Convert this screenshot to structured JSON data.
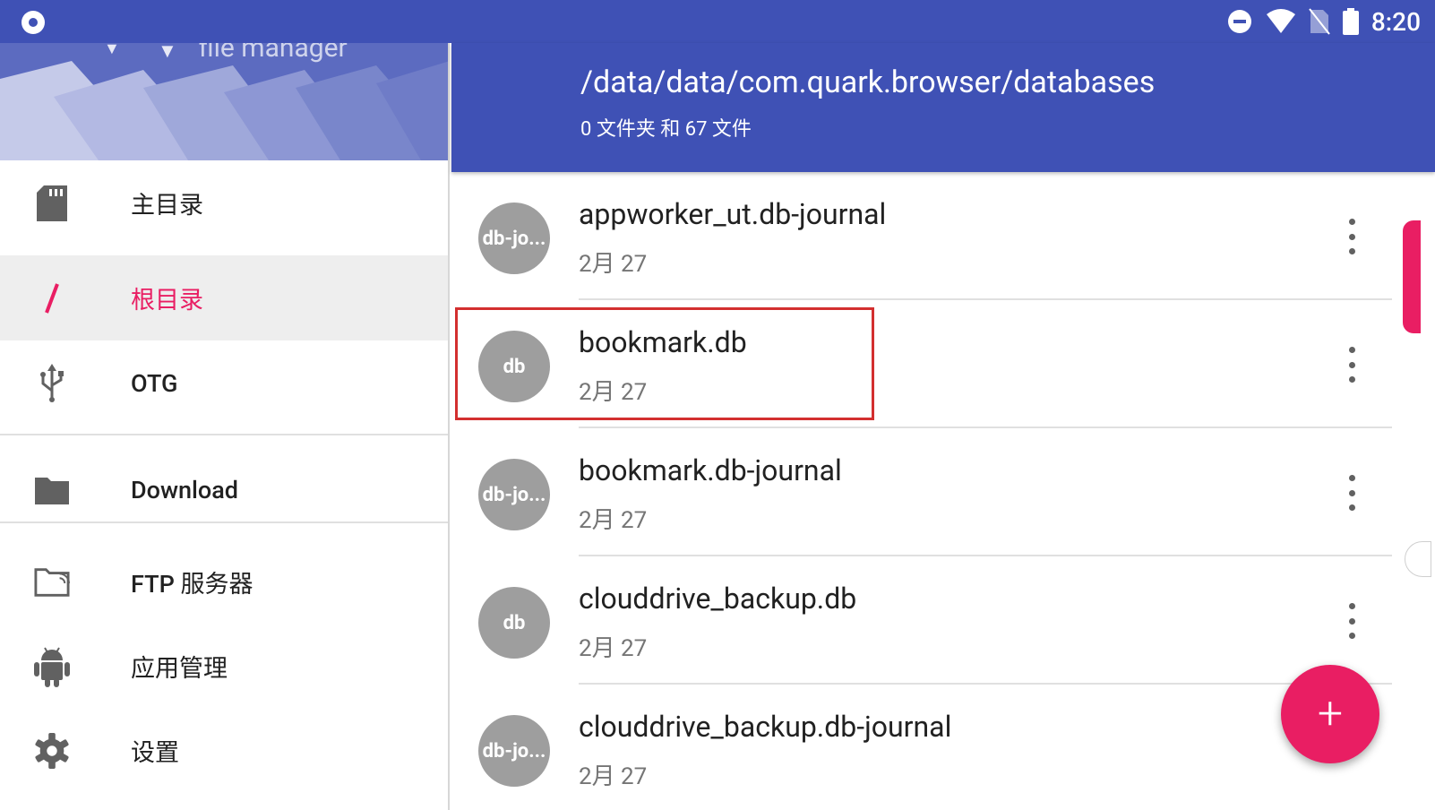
{
  "status_bar": {
    "time": "8:20",
    "icons": [
      "dnd-icon",
      "wifi-icon",
      "no-sim-icon",
      "battery-icon"
    ]
  },
  "drawer": {
    "app_title": "file manager",
    "items": [
      {
        "label": "主目录",
        "icon": "sd-card-icon"
      },
      {
        "label": "根目录",
        "icon": "slash-icon",
        "active": true
      },
      {
        "label": "OTG",
        "icon": "usb-icon"
      },
      {
        "label": "Download",
        "icon": "folder-icon"
      },
      {
        "label": "FTP 服务器",
        "icon": "ftp-folder-icon"
      },
      {
        "label": "应用管理",
        "icon": "android-icon"
      },
      {
        "label": "设置",
        "icon": "gear-icon"
      }
    ]
  },
  "header": {
    "path": "/data/data/com.quark.browser/databases",
    "summary": "0 文件夹 和 67 文件"
  },
  "files": [
    {
      "avatar": "db-jo...",
      "name": "appworker_ut.db-journal",
      "date": "2月 27"
    },
    {
      "avatar": "db",
      "name": "bookmark.db",
      "date": "2月 27"
    },
    {
      "avatar": "db-jo...",
      "name": "bookmark.db-journal",
      "date": "2月 27"
    },
    {
      "avatar": "db",
      "name": "clouddrive_backup.db",
      "date": "2月 27"
    },
    {
      "avatar": "db-jo...",
      "name": "clouddrive_backup.db-journal",
      "date": "2月 27"
    }
  ],
  "fab": {
    "label": "+"
  },
  "colors": {
    "primary": "#3f51b5",
    "accent": "#e91e63",
    "avatar": "#9e9e9e"
  }
}
